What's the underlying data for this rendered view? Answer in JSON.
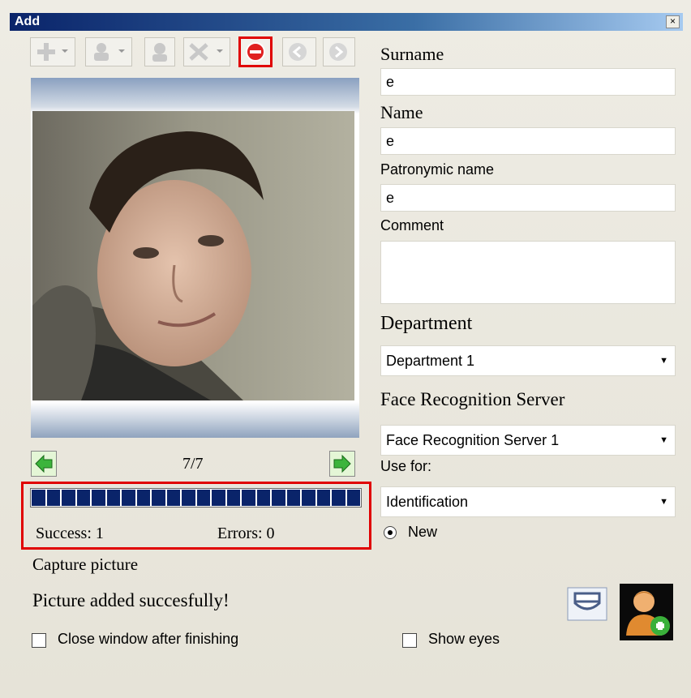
{
  "window": {
    "title": "Add",
    "close_glyph": "×"
  },
  "toolbar": {
    "buttons": [
      {
        "name": "add-icon"
      },
      {
        "name": "person-icon"
      },
      {
        "name": "person-profile-icon"
      },
      {
        "name": "delete-icon"
      },
      {
        "name": "stop-icon",
        "highlighted": true
      },
      {
        "name": "back-icon"
      },
      {
        "name": "forward-icon"
      }
    ]
  },
  "photo": {
    "counter": "7/7"
  },
  "progress": {
    "segments": 22,
    "fill": 1.0,
    "color": "#0a246a"
  },
  "stats": {
    "success": "Success: 1",
    "errors": "Errors: 0"
  },
  "capture": {
    "label": "Capture picture",
    "message": "Picture added succesfully!"
  },
  "checkboxes": {
    "close_window": "Close window after finishing",
    "show_eyes": "Show eyes"
  },
  "form": {
    "surname": {
      "label": "Surname",
      "value": "e"
    },
    "name": {
      "label": "Name",
      "value": "e"
    },
    "patronymic": {
      "label": "Patronymic name",
      "value": "e"
    },
    "comment": {
      "label": "Comment",
      "value": ""
    },
    "department": {
      "label": "Department",
      "value": "Department 1"
    },
    "server": {
      "label": "Face Recognition Server",
      "value": "Face Recognition Server 1"
    },
    "use_for": {
      "label": "Use for:",
      "value": "Identification"
    },
    "new_radio": {
      "label": "New"
    }
  },
  "colors": {
    "highlight": "#e00000",
    "title_bar": "#0a246a"
  }
}
